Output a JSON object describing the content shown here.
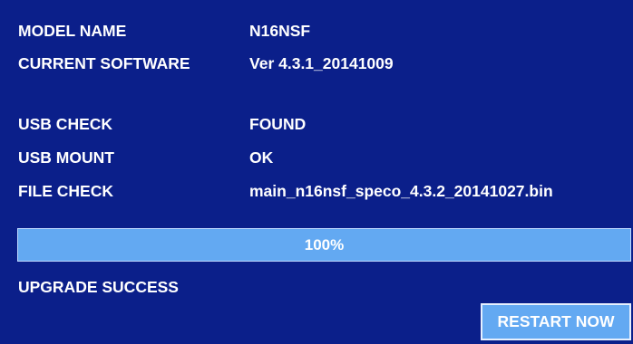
{
  "info": {
    "model_name_label": "MODEL NAME",
    "model_name_value": "N16NSF",
    "software_label": "CURRENT SOFTWARE",
    "software_value": "Ver 4.3.1_20141009",
    "usb_check_label": "USB CHECK",
    "usb_check_value": "FOUND",
    "usb_mount_label": "USB MOUNT",
    "usb_mount_value": "OK",
    "file_check_label": "FILE CHECK",
    "file_check_value": "main_n16nsf_speco_4.3.2_20141027.bin"
  },
  "progress": {
    "percent_text": "100%",
    "value": 1.0
  },
  "status": {
    "message": "UPGRADE SUCCESS"
  },
  "actions": {
    "restart_label": "RESTART NOW"
  },
  "colors": {
    "background": "#0b1f8a",
    "accent": "#63a9f2",
    "text": "#ffffff"
  }
}
